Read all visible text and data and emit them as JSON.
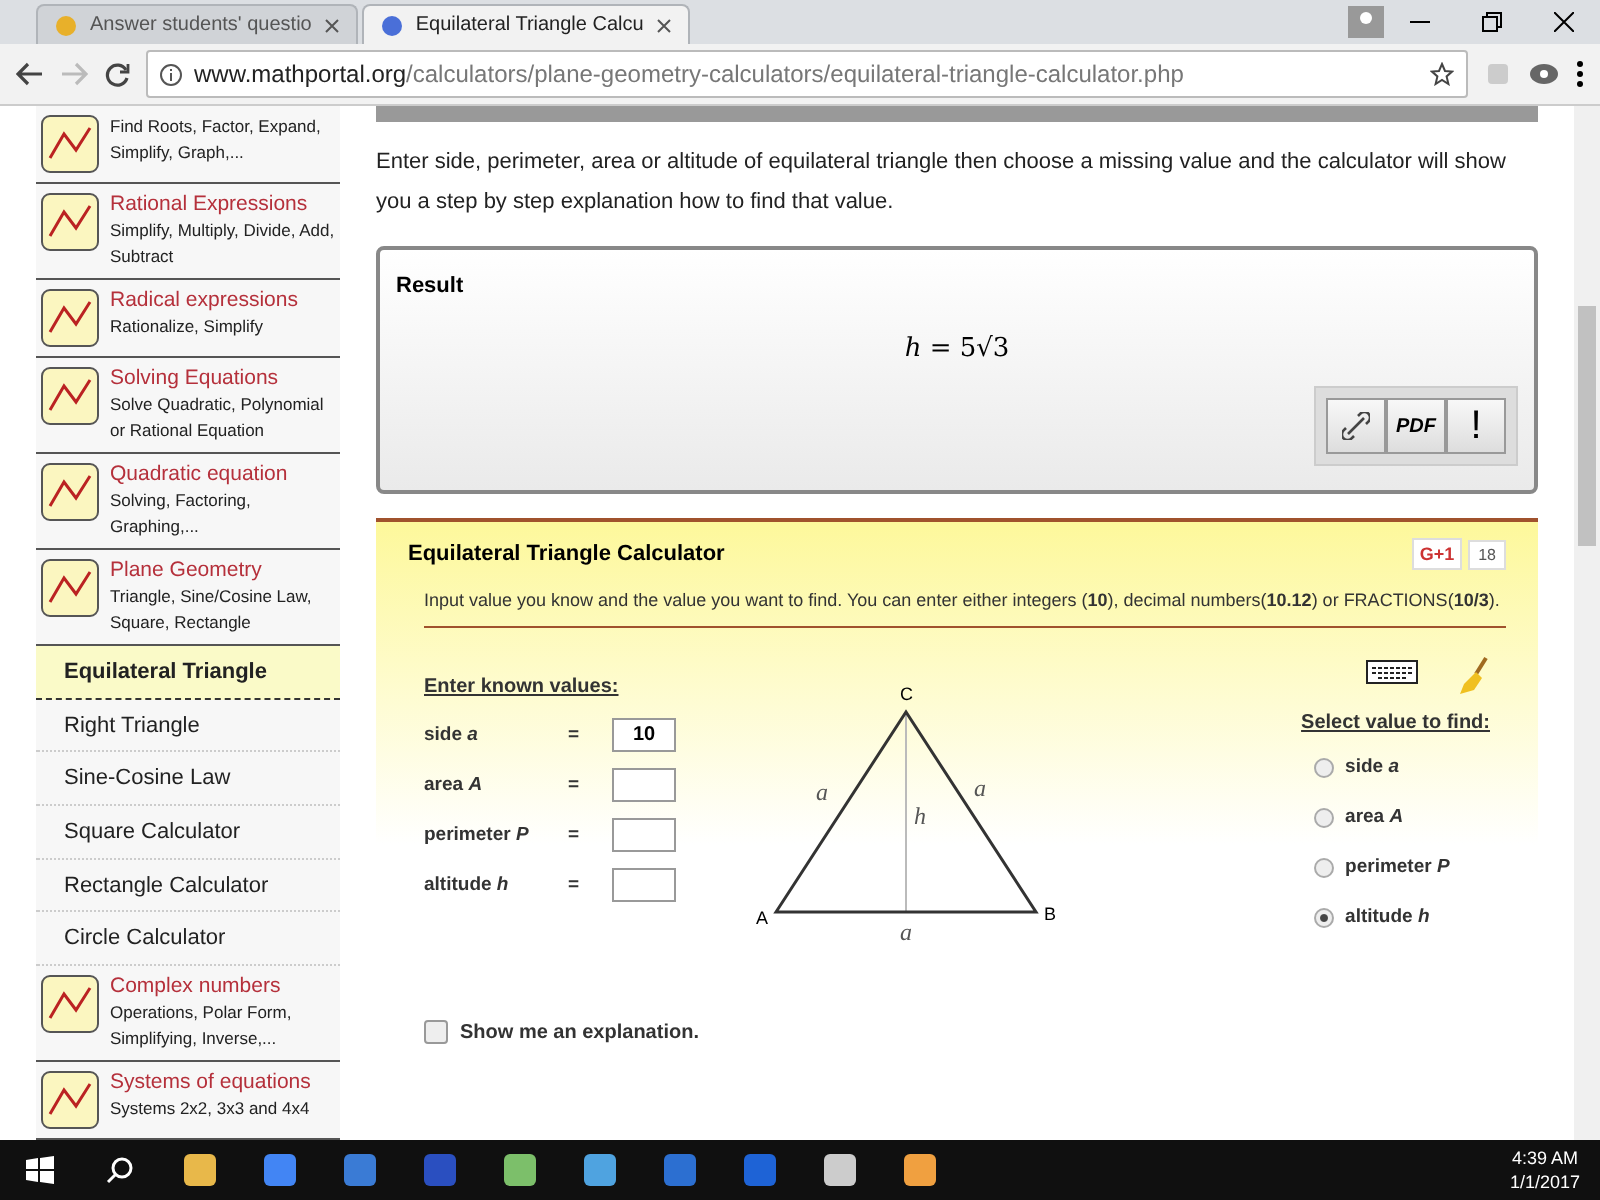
{
  "browser": {
    "tabs": [
      {
        "title": "Answer students' questio",
        "selected": false
      },
      {
        "title": "Equilateral Triangle Calcu",
        "selected": true
      }
    ],
    "url_host": "www.mathportal.org",
    "url_path": "/calculators/plane-geometry-calculators/equilateral-triangle-calculator.php"
  },
  "sidebar": {
    "items": [
      {
        "kind": "category",
        "description": "Find Roots, Factor, Expand, Simplify, Graph,..."
      },
      {
        "kind": "category",
        "title": "Rational Expressions",
        "description": "Simplify, Multiply, Divide, Add, Subtract"
      },
      {
        "kind": "category",
        "title": "Radical expressions",
        "description": "Rationalize, Simplify"
      },
      {
        "kind": "category",
        "title": "Solving Equations",
        "description": "Solve Quadratic, Polynomial or Rational Equation"
      },
      {
        "kind": "category",
        "title": "Quadratic equation",
        "description": "Solving, Factoring, Graphing,..."
      },
      {
        "kind": "category",
        "title": "Plane Geometry",
        "description": "Triangle, Sine/Cosine Law, Square, Rectangle"
      },
      {
        "kind": "link",
        "label": "Equilateral Triangle",
        "selected": true
      },
      {
        "kind": "link",
        "label": "Right Triangle",
        "selected": false
      },
      {
        "kind": "link",
        "label": "Sine-Cosine Law",
        "selected": false
      },
      {
        "kind": "link",
        "label": "Square Calculator",
        "selected": false
      },
      {
        "kind": "link",
        "label": "Rectangle Calculator",
        "selected": false
      },
      {
        "kind": "link",
        "label": "Circle Calculator",
        "selected": false
      },
      {
        "kind": "category",
        "title": "Complex numbers",
        "description": "Operations, Polar Form, Simplifying, Inverse,..."
      },
      {
        "kind": "category",
        "title": "Systems of equations",
        "description": "Systems 2x2, 3x3 and 4x4"
      }
    ]
  },
  "intro": "Enter side, perimeter, area or altitude of equilateral triangle then choose a missing value and the calculator will show you a step by step explanation how to find that value.",
  "result": {
    "label": "Result",
    "formula": "*h* = 5√3",
    "buttons": [
      {
        "kind": "link"
      },
      {
        "kind": "text",
        "label": "PDF"
      },
      {
        "kind": "text",
        "label": "!"
      }
    ]
  },
  "calculator": {
    "title": "Equilateral Triangle Calculator",
    "share_label": "G+1",
    "share_count": "18",
    "instructions": "Input value you know and the value you want to find. You can enter either integers (**10**), decimal numbers(**10.12**) or FRACTIONS(**10/3**).",
    "known_label": "Enter known values:",
    "fields": [
      {
        "label": "side *a*",
        "equals": "=",
        "value": "10"
      },
      {
        "label": "area *A*",
        "equals": "="
      },
      {
        "label": "perimeter *P*",
        "equals": "="
      },
      {
        "label": "altitude *h*",
        "equals": "="
      }
    ],
    "triangle": {
      "vertices": [
        "A",
        "B",
        "C"
      ],
      "sides": [
        "a",
        "a",
        "a"
      ],
      "altitude": "h"
    },
    "find_label": "Select value to find:",
    "options": [
      {
        "label": "side *a*",
        "selected": false
      },
      {
        "label": "area *A*",
        "selected": false
      },
      {
        "label": "perimeter *P*",
        "selected": false
      },
      {
        "label": "altitude *h*",
        "selected": true
      }
    ],
    "explanation": {
      "label": "Show me an explanation.",
      "checked": false
    }
  },
  "taskbar": {
    "time": "4:39 AM",
    "date": "1/1/2017"
  }
}
